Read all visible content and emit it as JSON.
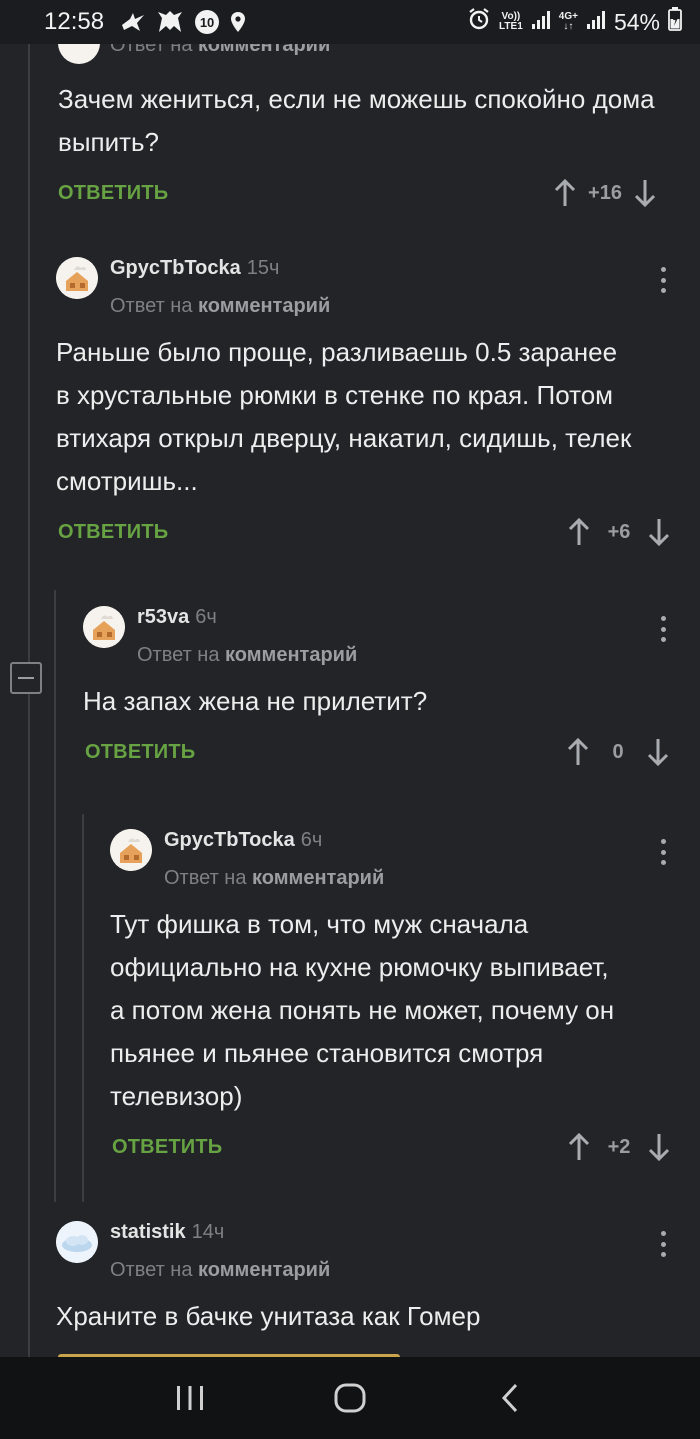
{
  "status_bar": {
    "time": "12:58",
    "notification_icons": [
      "bird-icon",
      "wolf-icon",
      "badge-10-icon",
      "location-icon"
    ],
    "badge_number": "10",
    "network_label_top": "Vo))",
    "network_label_bottom": "LTE1",
    "network_4g": "4G+",
    "battery_percent": "54%"
  },
  "thread": {
    "cut_off_reply": {
      "reply_prefix": "Ответ на",
      "reply_target": "комментарий"
    },
    "comments": [
      {
        "id": "c0",
        "text": "Зачем жениться, если не можешь спокойно дома выпить?",
        "reply_label": "ОТВЕТИТЬ",
        "score": "+16"
      },
      {
        "id": "c1",
        "author": "GpycTbTocka",
        "age": "15ч",
        "reply_prefix": "Ответ на",
        "reply_target": "комментарий",
        "text": "Раньше было проще, разливаешь 0.5 заранее в хрустальные рюмки в стенке по края. Потом втихаря открыл дверцу, накатил, сидишь, телек смотришь...",
        "reply_label": "ОТВЕТИТЬ",
        "score": "+6"
      },
      {
        "id": "c2",
        "author": "r53va",
        "age": "6ч",
        "reply_prefix": "Ответ на",
        "reply_target": "комментарий",
        "text": "На запах жена не прилетит?",
        "reply_label": "ОТВЕТИТЬ",
        "score": "0"
      },
      {
        "id": "c3",
        "author": "GpycTbTocka",
        "age": "6ч",
        "reply_prefix": "Ответ на",
        "reply_target": "комментарий",
        "text": "Тут фишка в том, что муж сначала официально на кухне рюмочку выпивает, а потом жена понять не может, почему он пьянее и пьянее становится смотря телевизор)",
        "reply_label": "ОТВЕТИТЬ",
        "score": "+2"
      },
      {
        "id": "c4",
        "author": "statistik",
        "age": "14ч",
        "reply_prefix": "Ответ на",
        "reply_target": "комментарий",
        "text": "Храните в бачке унитаза как Гомер"
      }
    ]
  },
  "colors": {
    "background": "#222427",
    "reply_green": "#67a243",
    "muted_text": "#7d8085",
    "thread_line": "#3a3d42"
  },
  "nav_bar": {
    "buttons": [
      "recent-apps-icon",
      "home-icon",
      "back-icon"
    ]
  }
}
